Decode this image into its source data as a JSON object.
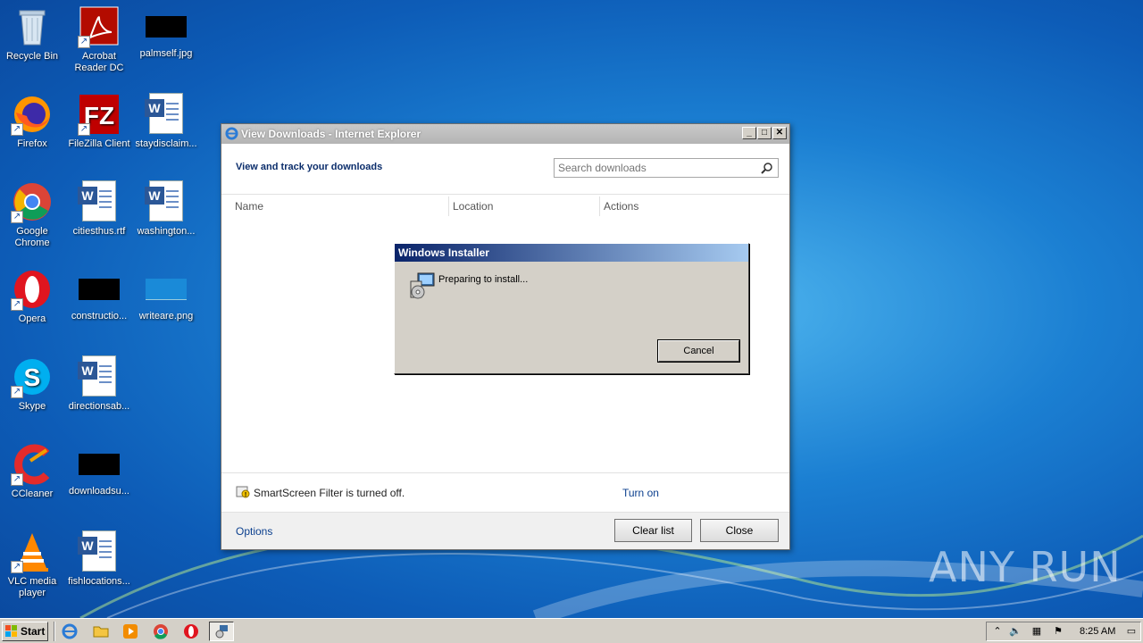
{
  "desktop": {
    "icons": [
      {
        "label": "Recycle Bin"
      },
      {
        "label": "Acrobat Reader DC"
      },
      {
        "label": "palmself.jpg"
      },
      {
        "label": "Firefox"
      },
      {
        "label": "FileZilla Client"
      },
      {
        "label": "staydisclaim..."
      },
      {
        "label": "Google Chrome"
      },
      {
        "label": "citiesthus.rtf"
      },
      {
        "label": "washington..."
      },
      {
        "label": "Opera"
      },
      {
        "label": "constructio..."
      },
      {
        "label": "writeare.png"
      },
      {
        "label": "Skype"
      },
      {
        "label": "directionsab..."
      },
      {
        "label": "CCleaner"
      },
      {
        "label": "downloadsu..."
      },
      {
        "label": "VLC media player"
      },
      {
        "label": "fishlocations..."
      }
    ]
  },
  "ie_window": {
    "title": "View Downloads - Internet Explorer",
    "header": "View and track your downloads",
    "search_placeholder": "Search downloads",
    "columns": {
      "name": "Name",
      "location": "Location",
      "actions": "Actions"
    },
    "smartscreen_message": "SmartScreen Filter is turned off.",
    "turn_on": "Turn on",
    "options": "Options",
    "clear_list": "Clear list",
    "close": "Close"
  },
  "installer": {
    "title": "Windows Installer",
    "message": "Preparing to install...",
    "cancel": "Cancel"
  },
  "taskbar": {
    "start": "Start",
    "clock": "8:25 AM"
  },
  "watermark": "ANY RUN",
  "colors": {
    "desktop_bg": "#1b7fd2",
    "installer_title_start": "#0a246a",
    "installer_title_end": "#a6caf0",
    "link": "#0b3f8e"
  }
}
